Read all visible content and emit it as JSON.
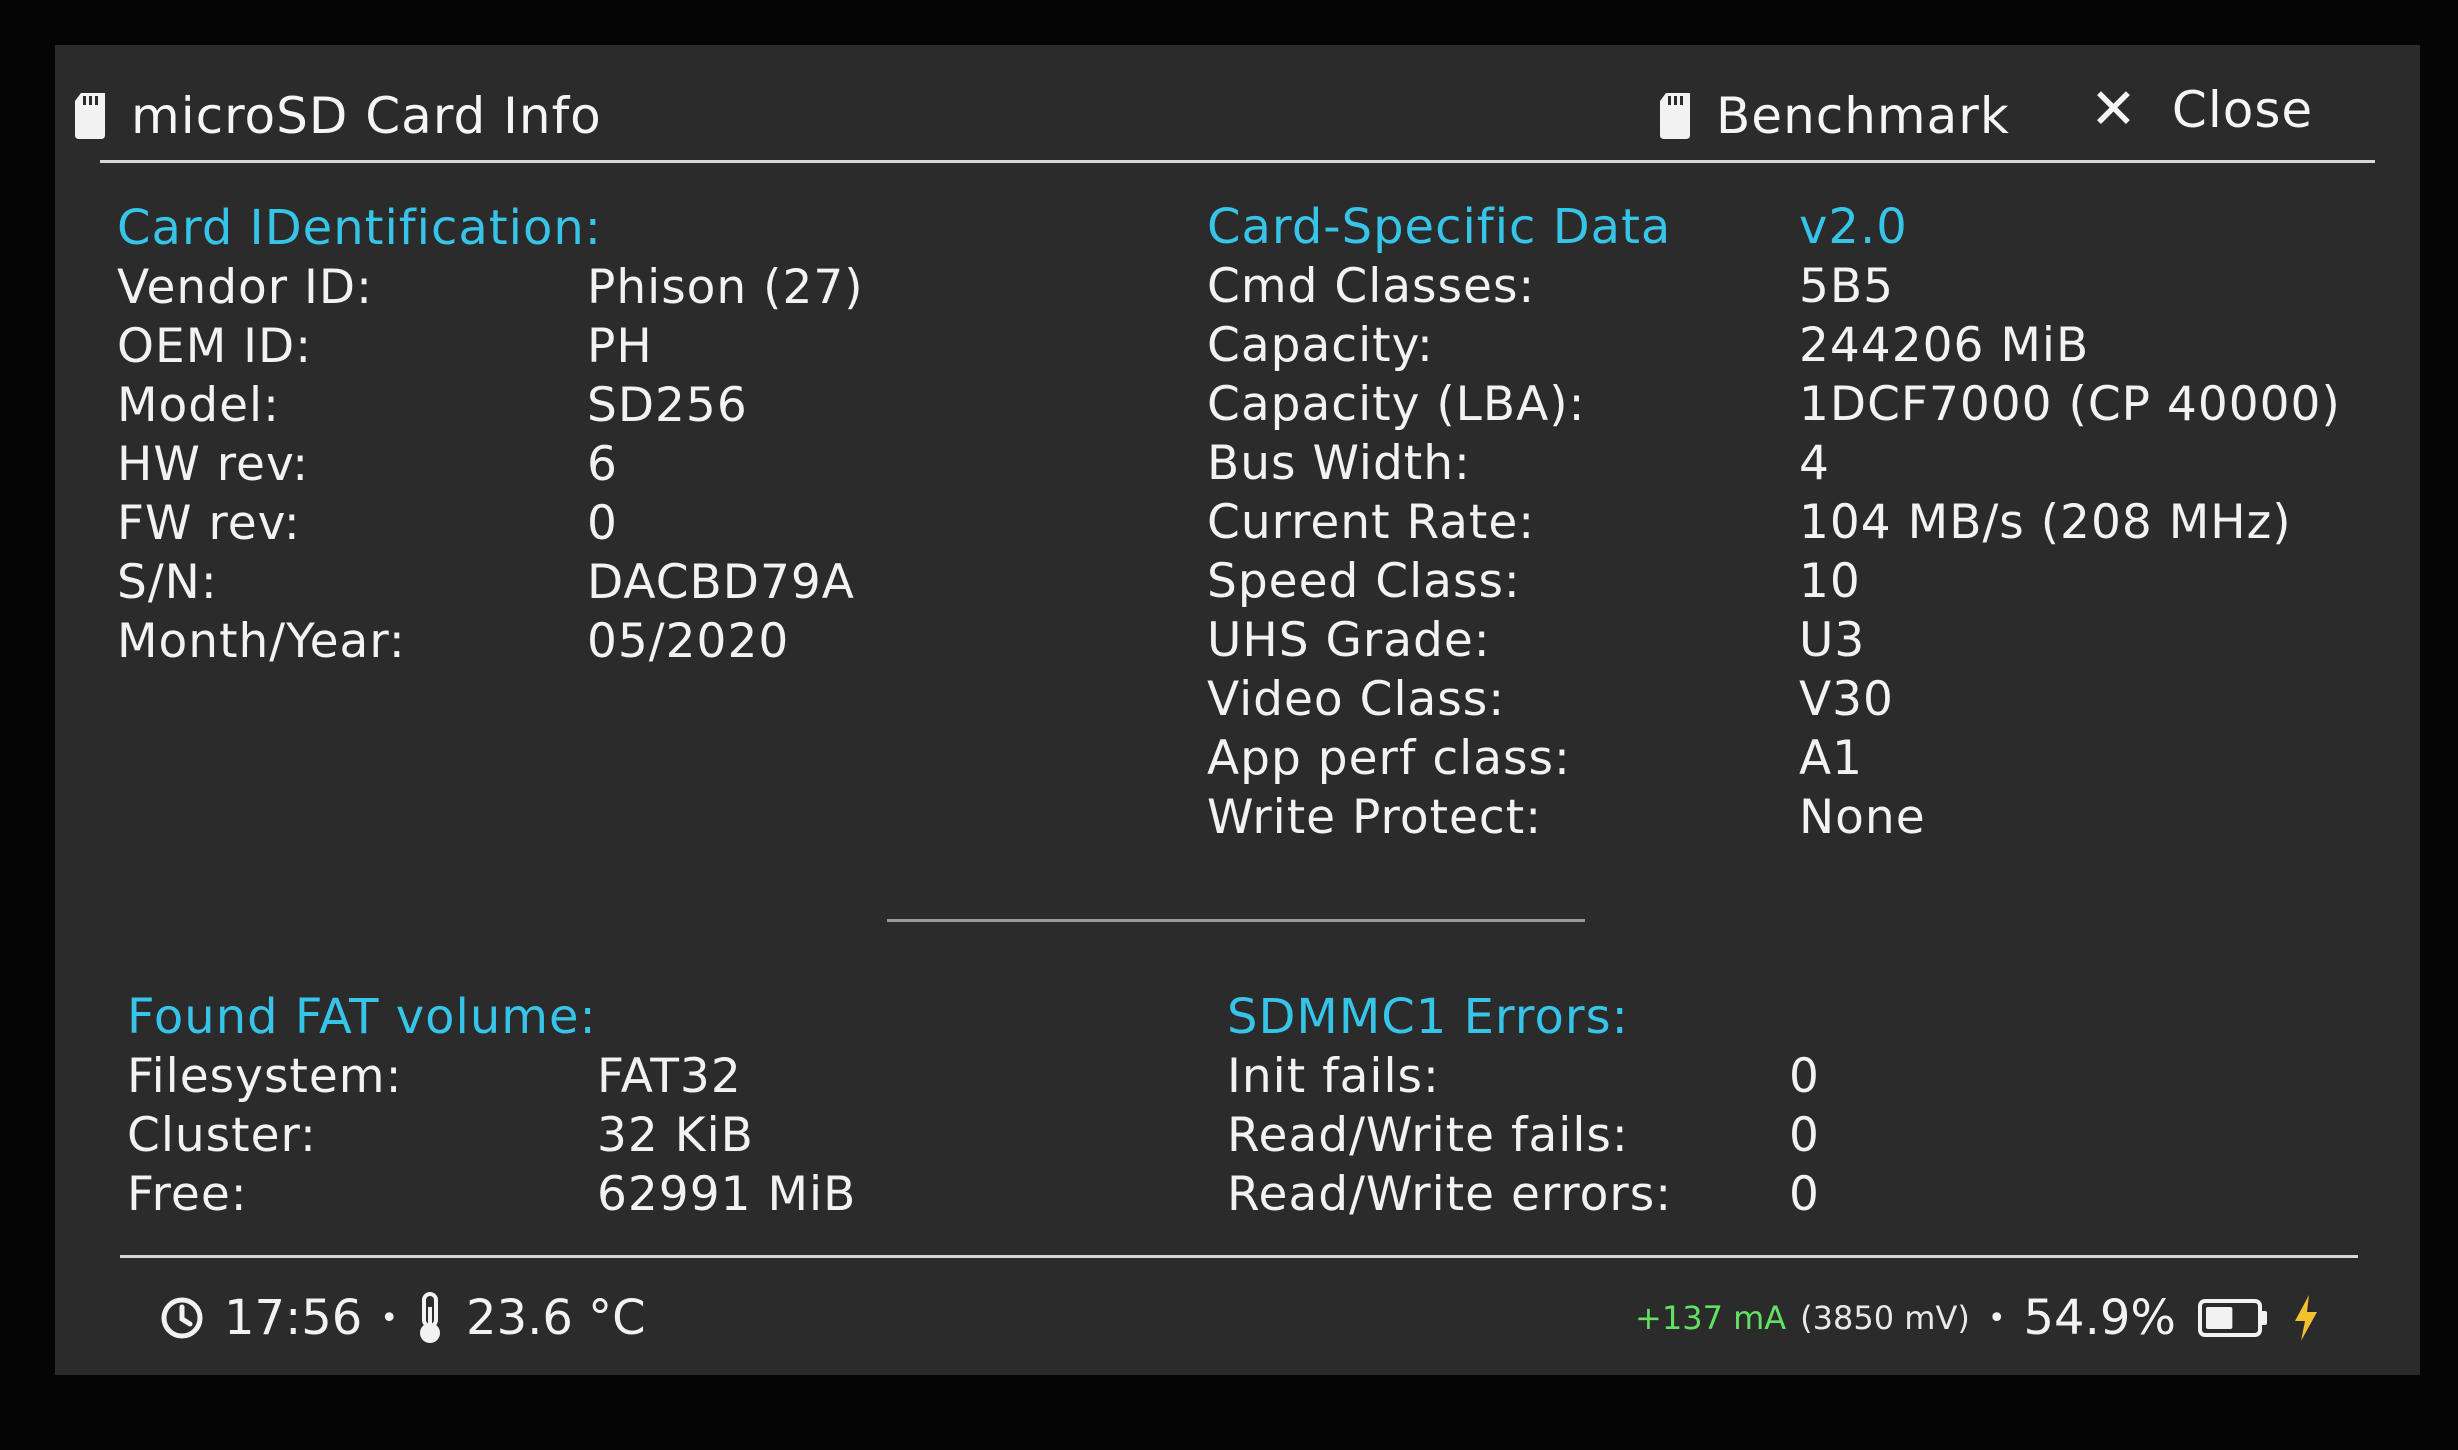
{
  "header": {
    "title": "microSD Card Info",
    "benchmark_label": "Benchmark",
    "close_label": "Close"
  },
  "cid": {
    "title": "Card IDentification:",
    "rows": [
      {
        "label": "Vendor ID:",
        "value": "Phison (27)"
      },
      {
        "label": "OEM ID:",
        "value": "PH"
      },
      {
        "label": "Model:",
        "value": "SD256"
      },
      {
        "label": "HW rev:",
        "value": "6"
      },
      {
        "label": "FW rev:",
        "value": "0"
      },
      {
        "label": "S/N:",
        "value": "DACBD79A"
      },
      {
        "label": "Month/Year:",
        "value": "05/2020"
      }
    ]
  },
  "csd": {
    "title": "Card-Specific Data",
    "version": "v2.0",
    "rows": [
      {
        "label": "Cmd Classes:",
        "value": "5B5"
      },
      {
        "label": "Capacity:",
        "value": "244206 MiB"
      },
      {
        "label": "Capacity (LBA):",
        "value": "1DCF7000 (CP 40000)"
      },
      {
        "label": "Bus Width:",
        "value": "4"
      },
      {
        "label": "Current Rate:",
        "value": "104 MB/s (208 MHz)"
      },
      {
        "label": "Speed Class:",
        "value": "10"
      },
      {
        "label": "UHS Grade:",
        "value": "U3"
      },
      {
        "label": "Video Class:",
        "value": "V30"
      },
      {
        "label": "App perf class:",
        "value": "A1"
      },
      {
        "label": "Write Protect:",
        "value": "None"
      }
    ]
  },
  "fat": {
    "title": "Found FAT volume:",
    "rows": [
      {
        "label": "Filesystem:",
        "value": "FAT32"
      },
      {
        "label": "Cluster:",
        "value": "32 KiB"
      },
      {
        "label": "Free:",
        "value": "62991 MiB"
      }
    ]
  },
  "errors": {
    "title": "SDMMC1 Errors:",
    "rows": [
      {
        "label": "Init fails:",
        "value": "0"
      },
      {
        "label": "Read/Write fails:",
        "value": "0"
      },
      {
        "label": "Read/Write errors:",
        "value": "0"
      }
    ]
  },
  "status": {
    "time": "17:56",
    "temperature": "23.6 °C",
    "current": "+137 mA",
    "voltage": "(3850 mV)",
    "battery_percent": "54.9%",
    "battery_level": 0.549,
    "charging": true
  },
  "colors": {
    "accent": "#36c4e8",
    "current_positive": "#62e064",
    "charging_bolt": "#f2c12e",
    "background": "#2b2b2b"
  },
  "icons": [
    "sd-card-icon",
    "close-icon",
    "clock-icon",
    "thermometer-icon",
    "battery-icon",
    "charging-bolt-icon"
  ]
}
